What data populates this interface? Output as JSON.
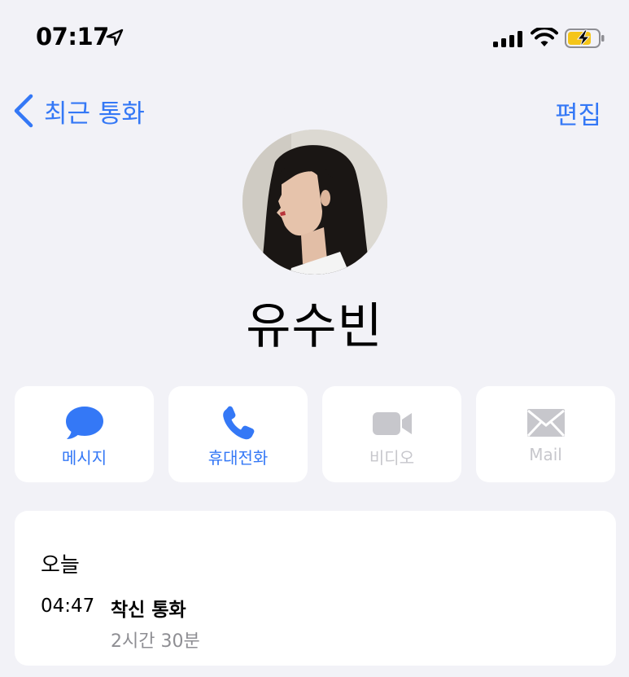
{
  "status_bar": {
    "time": "07:17",
    "icons": [
      "location-arrow-icon",
      "cellular-signal-icon",
      "wifi-icon",
      "battery-charging-icon"
    ]
  },
  "nav": {
    "back_label": "최근 통화",
    "edit_label": "편집"
  },
  "contact": {
    "name": "유수빈"
  },
  "actions": [
    {
      "label": "메시지",
      "icon": "message-bubble-icon",
      "enabled": true
    },
    {
      "label": "휴대전화",
      "icon": "phone-icon",
      "enabled": true
    },
    {
      "label": "비디오",
      "icon": "video-camera-icon",
      "enabled": false
    },
    {
      "label": "Mail",
      "icon": "mail-envelope-icon",
      "enabled": false
    }
  ],
  "call_history": {
    "day": "오늘",
    "entries": [
      {
        "time": "04:47",
        "type": "착신 통화",
        "duration": "2시간 30분"
      }
    ]
  },
  "colors": {
    "accent": "#3478f6",
    "background": "#f2f2f7",
    "card": "#ffffff",
    "disabled": "#c7c7cc",
    "secondary_text": "#8e8e93",
    "battery_fill": "#f5c518"
  }
}
